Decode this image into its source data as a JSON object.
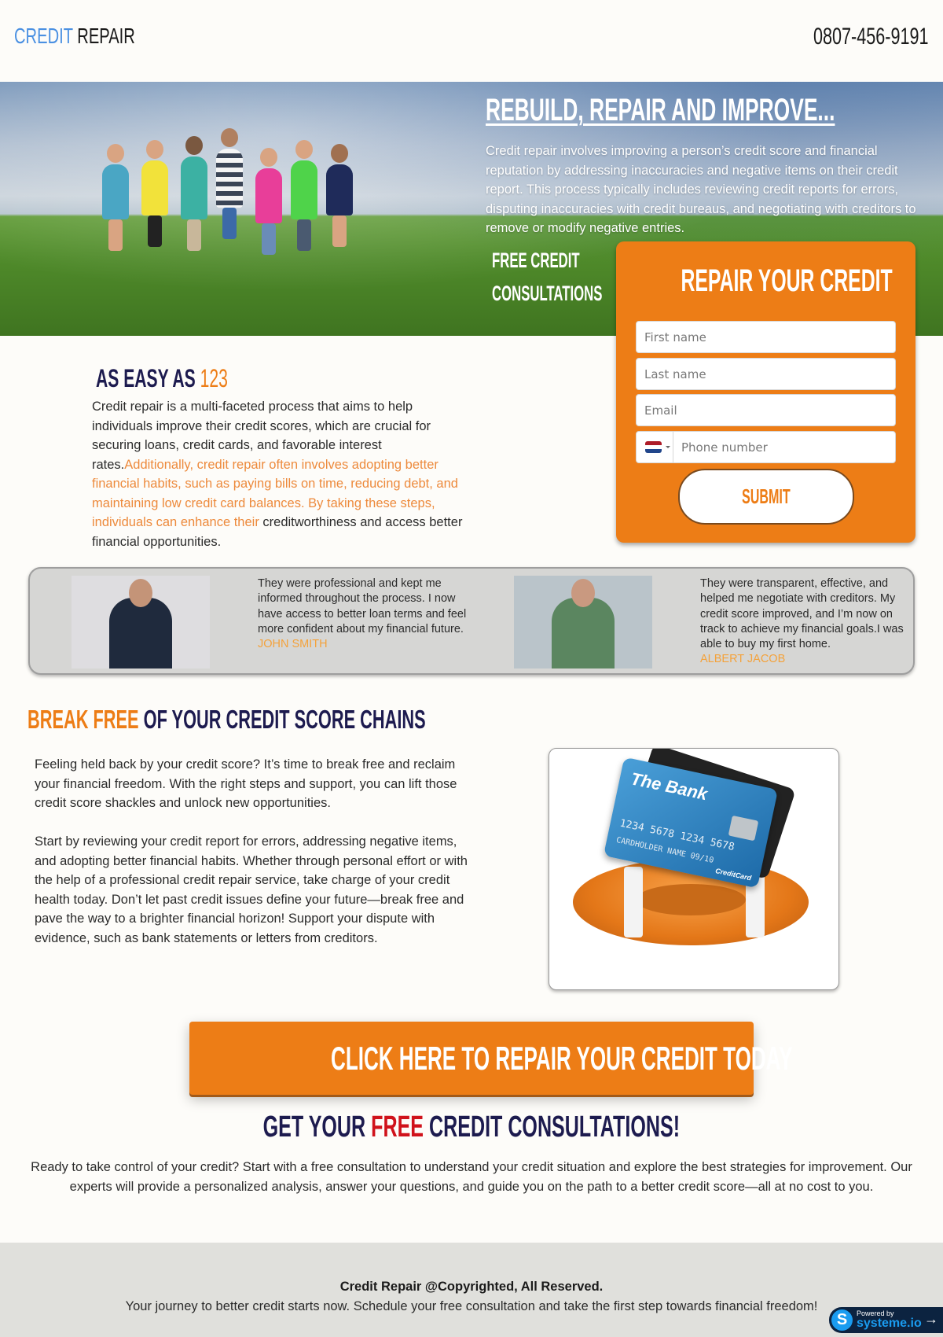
{
  "header": {
    "logo_part1": "CREDIT",
    "logo_part2": "REPAIR",
    "phone": "0807-456-9191"
  },
  "hero": {
    "image_alt": "children jumping in a green field",
    "title": "REBUILD, REPAIR AND IMPROVE...",
    "description": "Credit repair involves improving a person’s credit score and financial reputation by addressing inaccuracies and negative items on their credit report. This process typically includes reviewing credit reports for errors, disputing inaccuracies with credit bureaus, and negotiating with creditors to remove or modify negative entries.",
    "subtitle_line1": "FREE CREDIT",
    "subtitle_line2": "CONSULTATIONS"
  },
  "form": {
    "title": "REPAIR YOUR CREDIT",
    "first_name_placeholder": "First name",
    "last_name_placeholder": "Last name",
    "email_placeholder": "Email",
    "phone_placeholder": "Phone number",
    "country_flag": "Netherlands",
    "submit_label": "SUBMIT"
  },
  "easy": {
    "title_part1": "AS EASY AS",
    "title_part2": "123",
    "text_part1": "Credit repair is a multi-faceted process that aims to help individuals improve their credit scores, which are crucial for securing loans, credit cards, and favorable interest rates.",
    "text_highlight": "Additionally, credit repair often involves adopting better financial habits, such as paying bills on time, reducing debt, and maintaining low credit card balances. By taking these steps, individuals can enhance their",
    "text_part2": " creditworthiness and access better financial opportunities."
  },
  "testimonials": [
    {
      "quote": "They were professional and kept me informed throughout the process. I now have access to better loan terms and feel more confident about my financial future.",
      "name": "JOHN SMITH"
    },
    {
      "quote": "They were transparent, effective, and helped me negotiate with creditors. My credit score improved, and I’m now on track to achieve my financial goals.I was able to buy my first home.",
      "name": "ALBERT JACOB"
    }
  ],
  "break_free": {
    "title_part1": "BREAK FREE",
    "title_part2": "OF YOUR CREDIT SCORE CHAINS",
    "paragraph1": "Feeling held back by your credit score? It’s time to break free and reclaim your financial freedom. With the right steps and support, you can lift those credit score shackles and unlock new opportunities.",
    "paragraph2": "Start by reviewing your credit report for errors, addressing negative items, and adopting better financial habits. Whether through personal effort or with the help of a professional credit repair service, take charge of your credit health today. Don’t let past credit issues define your future—break free and pave the way to a brighter financial horizon! Support your dispute with evidence, such as bank statements or letters from creditors.",
    "card_image": {
      "bank_name": "The Bank",
      "card_number": "1234 5678 1234 5678",
      "expiry": "09/10",
      "holder": "CARDHOLDER NAME",
      "brand": "CreditCard"
    }
  },
  "cta": {
    "button_label": "CLICK HERE TO REPAIR YOUR CREDIT TODAY",
    "consult_title_part1": "GET YOUR",
    "consult_title_part2": "FREE",
    "consult_title_part3": "CREDIT CONSULTATIONS!",
    "consult_text": "Ready to take control of your credit? Start with a free consultation to understand your credit situation and explore the best strategies for improvement. Our experts will provide a personalized analysis, answer your questions, and guide you on the path to a better credit score—all at no cost to you."
  },
  "footer": {
    "copyright": "Credit Repair @Copyrighted, All Reserved.",
    "tagline": "Your journey to better credit starts now. Schedule your free consultation and take the first step towards financial freedom!",
    "badge_small": "Powered by",
    "badge_brand": "systeme.io",
    "badge_logo_letter": "S",
    "badge_arrow": "→"
  },
  "colors": {
    "accent_orange": "#ed7d16",
    "navy": "#1d1b4f",
    "logo_blue": "#4a90e2",
    "free_red": "#d0121b",
    "testimonial_name": "#f4a23b"
  }
}
